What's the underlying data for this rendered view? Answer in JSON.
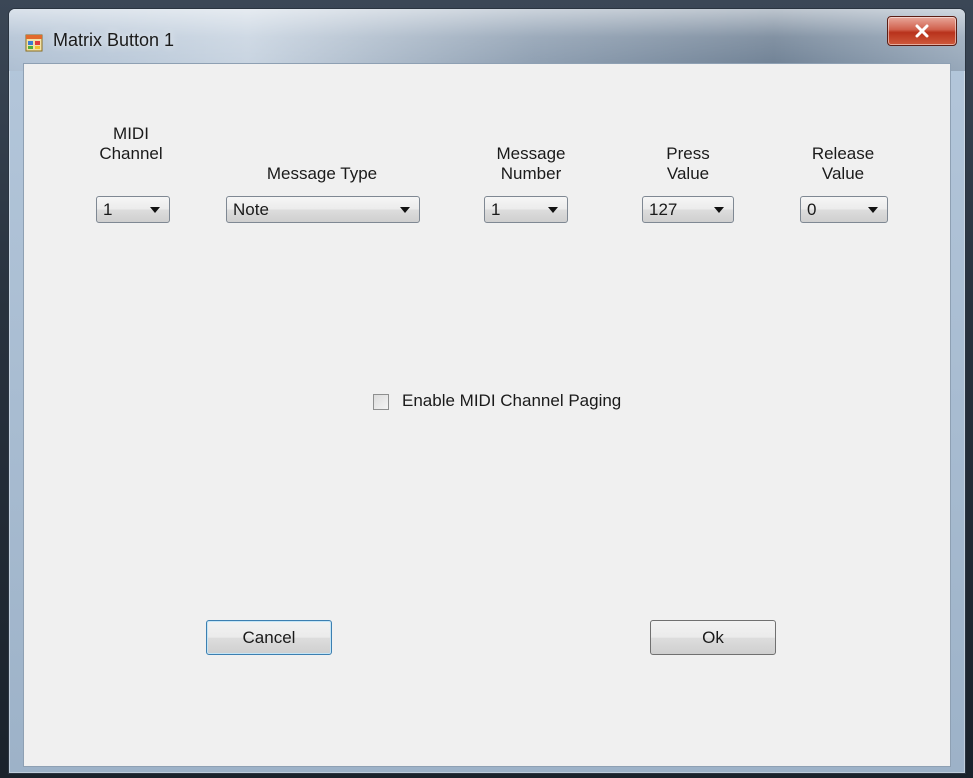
{
  "window": {
    "title": "Matrix Button 1",
    "close_glyph": "x",
    "icon": "app-window-icon"
  },
  "fields": {
    "midi_channel": {
      "label": "MIDI\nChannel",
      "value": "1"
    },
    "message_type": {
      "label": "Message Type",
      "value": "Note"
    },
    "message_number": {
      "label": "Message\nNumber",
      "value": "1"
    },
    "press_value": {
      "label": "Press\nValue",
      "value": "127"
    },
    "release_value": {
      "label": "Release\nValue",
      "value": "0"
    }
  },
  "paging": {
    "label": "Enable MIDI Channel Paging",
    "checked": false
  },
  "buttons": {
    "cancel": "Cancel",
    "ok": "Ok"
  },
  "colors": {
    "client_bg": "#f0f0f0",
    "close_red": "#c8402a",
    "focus_border": "#3c7fb1"
  }
}
